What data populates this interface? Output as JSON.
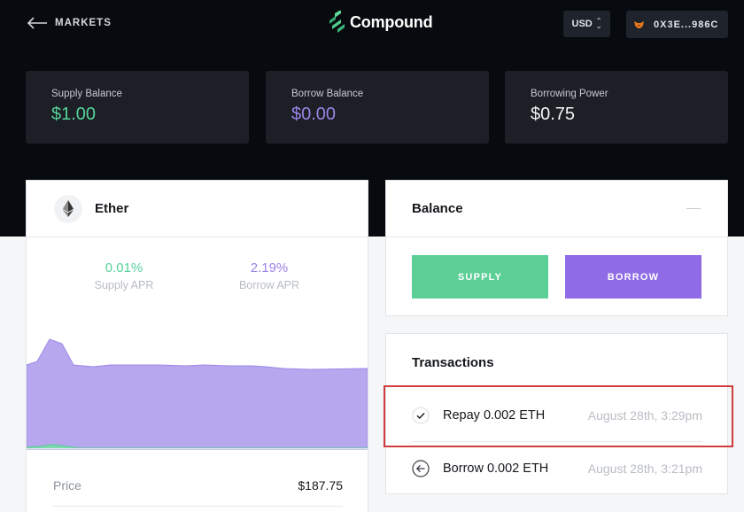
{
  "header": {
    "back_label": "MARKETS",
    "brand": "Compound",
    "currency": "USD",
    "wallet_address": "0X3E...986C"
  },
  "balances": {
    "supply_label": "Supply Balance",
    "supply_value": "$1.00",
    "borrow_label": "Borrow Balance",
    "borrow_value": "$0.00",
    "power_label": "Borrowing Power",
    "power_value": "$0.75"
  },
  "asset": {
    "name": "Ether",
    "supply_apr": "0.01%",
    "supply_apr_label": "Supply APR",
    "borrow_apr": "2.19%",
    "borrow_apr_label": "Borrow APR",
    "price_label": "Price",
    "price_value": "$187.75"
  },
  "balance_panel": {
    "title": "Balance",
    "supply_button": "SUPPLY",
    "borrow_button": "BORROW"
  },
  "transactions": {
    "title": "Transactions",
    "items": [
      {
        "label": "Repay 0.002 ETH",
        "time": "August 28th, 3:29pm",
        "icon": "check-circle-icon"
      },
      {
        "label": "Borrow 0.002 ETH",
        "time": "August 28th, 3:21pm",
        "icon": "arrow-left-circle-icon"
      }
    ]
  },
  "colors": {
    "supply_green": "#5ccf96",
    "borrow_purple": "#8f6be6",
    "chart_area": "#b7a7ef",
    "highlight_red": "#d03d3d"
  }
}
